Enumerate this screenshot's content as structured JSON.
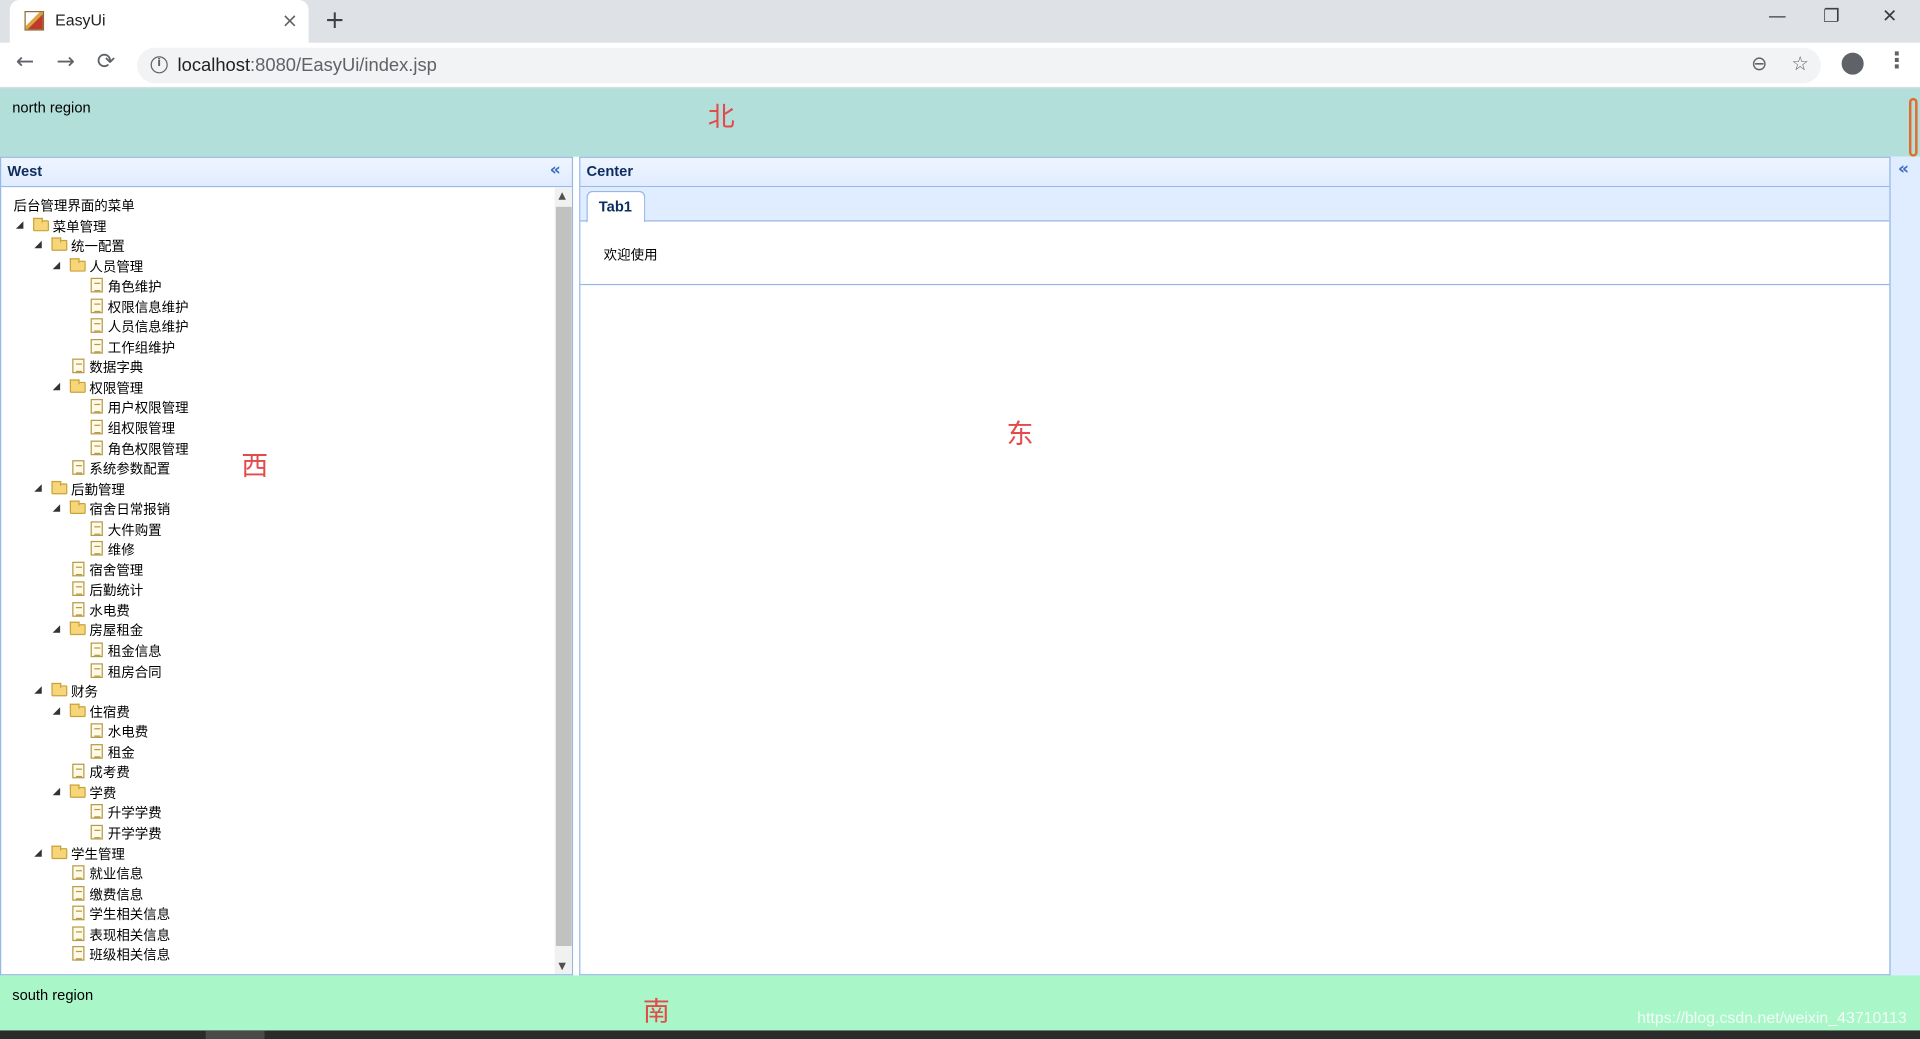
{
  "browser": {
    "tab_title": "EasyUi",
    "tab_close": "×",
    "new_tab": "+",
    "window_minimize": "—",
    "window_restore": "❐",
    "window_close": "✕",
    "back": "←",
    "forward": "→",
    "reload": "⟳",
    "info": "i",
    "url_host": "localhost",
    "url_path": ":8080/EasyUi/index.jsp",
    "zoom_icon": "⊖",
    "star_icon": "☆",
    "menu_icon": "⋮"
  },
  "layout": {
    "north_text": "north region",
    "north_cn": "北",
    "west_title": "West",
    "west_cn": "西",
    "center_title": "Center",
    "east_cn": "东",
    "south_text": "south region",
    "south_cn": "南",
    "collapse_glyph": "«"
  },
  "tree": {
    "root": "后台管理界面的菜单",
    "nodes": [
      {
        "label": "菜单管理",
        "level": 1,
        "type": "folder"
      },
      {
        "label": "统一配置",
        "level": 2,
        "type": "folder"
      },
      {
        "label": "人员管理",
        "level": 3,
        "type": "folder"
      },
      {
        "label": "角色维护",
        "level": 4,
        "type": "file"
      },
      {
        "label": "权限信息维护",
        "level": 4,
        "type": "file"
      },
      {
        "label": "人员信息维护",
        "level": 4,
        "type": "file"
      },
      {
        "label": "工作组维护",
        "level": 4,
        "type": "file"
      },
      {
        "label": "数据字典",
        "level": 3,
        "type": "file"
      },
      {
        "label": "权限管理",
        "level": 3,
        "type": "folder"
      },
      {
        "label": "用户权限管理",
        "level": 4,
        "type": "file"
      },
      {
        "label": "组权限管理",
        "level": 4,
        "type": "file"
      },
      {
        "label": "角色权限管理",
        "level": 4,
        "type": "file"
      },
      {
        "label": "系统参数配置",
        "level": 3,
        "type": "file"
      },
      {
        "label": "后勤管理",
        "level": 2,
        "type": "folder"
      },
      {
        "label": "宿舍日常报销",
        "level": 3,
        "type": "folder"
      },
      {
        "label": "大件购置",
        "level": 4,
        "type": "file"
      },
      {
        "label": "维修",
        "level": 4,
        "type": "file"
      },
      {
        "label": "宿舍管理",
        "level": 3,
        "type": "file"
      },
      {
        "label": "后勤统计",
        "level": 3,
        "type": "file"
      },
      {
        "label": "水电费",
        "level": 3,
        "type": "file"
      },
      {
        "label": "房屋租金",
        "level": 3,
        "type": "folder"
      },
      {
        "label": "租金信息",
        "level": 4,
        "type": "file"
      },
      {
        "label": "租房合同",
        "level": 4,
        "type": "file"
      },
      {
        "label": "财务",
        "level": 2,
        "type": "folder"
      },
      {
        "label": "住宿费",
        "level": 3,
        "type": "folder"
      },
      {
        "label": "水电费",
        "level": 4,
        "type": "file"
      },
      {
        "label": "租金",
        "level": 4,
        "type": "file"
      },
      {
        "label": "成考费",
        "level": 3,
        "type": "file"
      },
      {
        "label": "学费",
        "level": 3,
        "type": "folder"
      },
      {
        "label": "升学学费",
        "level": 4,
        "type": "file"
      },
      {
        "label": "开学学费",
        "level": 4,
        "type": "file"
      },
      {
        "label": "学生管理",
        "level": 2,
        "type": "folder"
      },
      {
        "label": "就业信息",
        "level": 3,
        "type": "file"
      },
      {
        "label": "缴费信息",
        "level": 3,
        "type": "file"
      },
      {
        "label": "学生相关信息",
        "level": 3,
        "type": "file"
      },
      {
        "label": "表现相关信息",
        "level": 3,
        "type": "file"
      },
      {
        "label": "班级相关信息",
        "level": 3,
        "type": "file"
      }
    ]
  },
  "tabs": [
    {
      "label": "Tab1",
      "content": "欢迎使用"
    }
  ],
  "watermark": "https://blog.csdn.net/weixin_43710113"
}
